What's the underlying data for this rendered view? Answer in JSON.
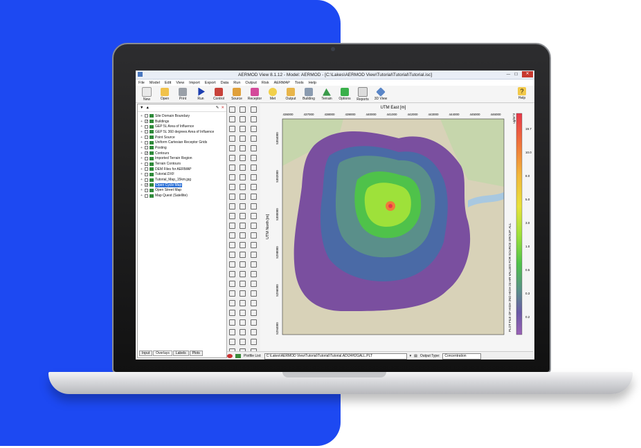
{
  "window": {
    "title": "AERMOD View 8.1.12 - Model: AERMOD - [C:\\Lakes\\AERMOD View\\Tutorial\\Tutorial\\Tutorial.isc]"
  },
  "menu": [
    "File",
    "Model",
    "Edit",
    "View",
    "Import",
    "Export",
    "Data",
    "Run",
    "Output",
    "Risk",
    "AERMAP",
    "Tools",
    "Help"
  ],
  "toolbar": [
    "New",
    "Open",
    "Print",
    "Run",
    "Control",
    "Source",
    "Receptor",
    "Met",
    "Output",
    "Building",
    "Terrain",
    "Options",
    "Reports",
    "3D View"
  ],
  "help_label": "Help",
  "tree": [
    {
      "label": "Site Domain Boundary",
      "checked": false
    },
    {
      "label": "Buildings",
      "checked": true
    },
    {
      "label": "GEP 5L Area of Influence",
      "checked": false
    },
    {
      "label": "GEP 5L 360 degrees Area of Influence",
      "checked": false
    },
    {
      "label": "Point Source",
      "checked": false
    },
    {
      "label": "Uniform Cartesian Receptor Grids",
      "checked": false
    },
    {
      "label": "Posting",
      "checked": false
    },
    {
      "label": "Contours",
      "checked": true
    },
    {
      "label": "Imported Terrain Region",
      "checked": false
    },
    {
      "label": "Terrain Contours",
      "checked": false
    },
    {
      "label": "DEM Files for AERMAP",
      "checked": false
    },
    {
      "label": "Tutorial.DXF",
      "checked": false
    },
    {
      "label": "Tutorial_Map_15km.jpg",
      "checked": false
    },
    {
      "label": "Open Cycle Map",
      "checked": true,
      "selected": true
    },
    {
      "label": "Open Street Map",
      "checked": false
    },
    {
      "label": "Map Quest (Satellite)",
      "checked": false
    }
  ],
  "tabs": [
    "Input",
    "Overlays",
    "Labels",
    "Plots"
  ],
  "map": {
    "x_axis_title": "UTM East [m]",
    "y_axis_title": "UTM North [m]",
    "x_ticks": [
      "436000",
      "437000",
      "438000",
      "439000",
      "440000",
      "441000",
      "442000",
      "443000",
      "444000",
      "445000",
      "446000"
    ],
    "y_ticks": [
      "5304000",
      "5302000",
      "5300000",
      "5298000",
      "5296000",
      "5294000"
    ],
    "legend_unit": "ug/m^3",
    "legend_title": "PLOT FILE OF HIGH 2ND HIGH 24-HR VALUES FOR SOURCE GROUP: ALL",
    "legend_values": [
      "19.7",
      "10.0",
      "8.0",
      "5.0",
      "3.0",
      "1.0",
      "0.5",
      "0.3",
      "0.2"
    ],
    "legend_colors": [
      "#e8374a",
      "#f07a3a",
      "#f2b73a",
      "#e8e23a",
      "#b6e13a",
      "#5fcf4a",
      "#5a9a6a",
      "#4a6aa6",
      "#7a4f9f",
      "#9a62b5"
    ]
  },
  "bottom": {
    "plotfile_label": "Plotfile List:",
    "plotfile_value": "C:\\Lakes\\AERMOD View\\Tutorial\\Tutorial\\Tutorial.AD\\24H2GALL.PLT",
    "output_type_label": "Output Type:",
    "output_type_value": "Concentration"
  }
}
